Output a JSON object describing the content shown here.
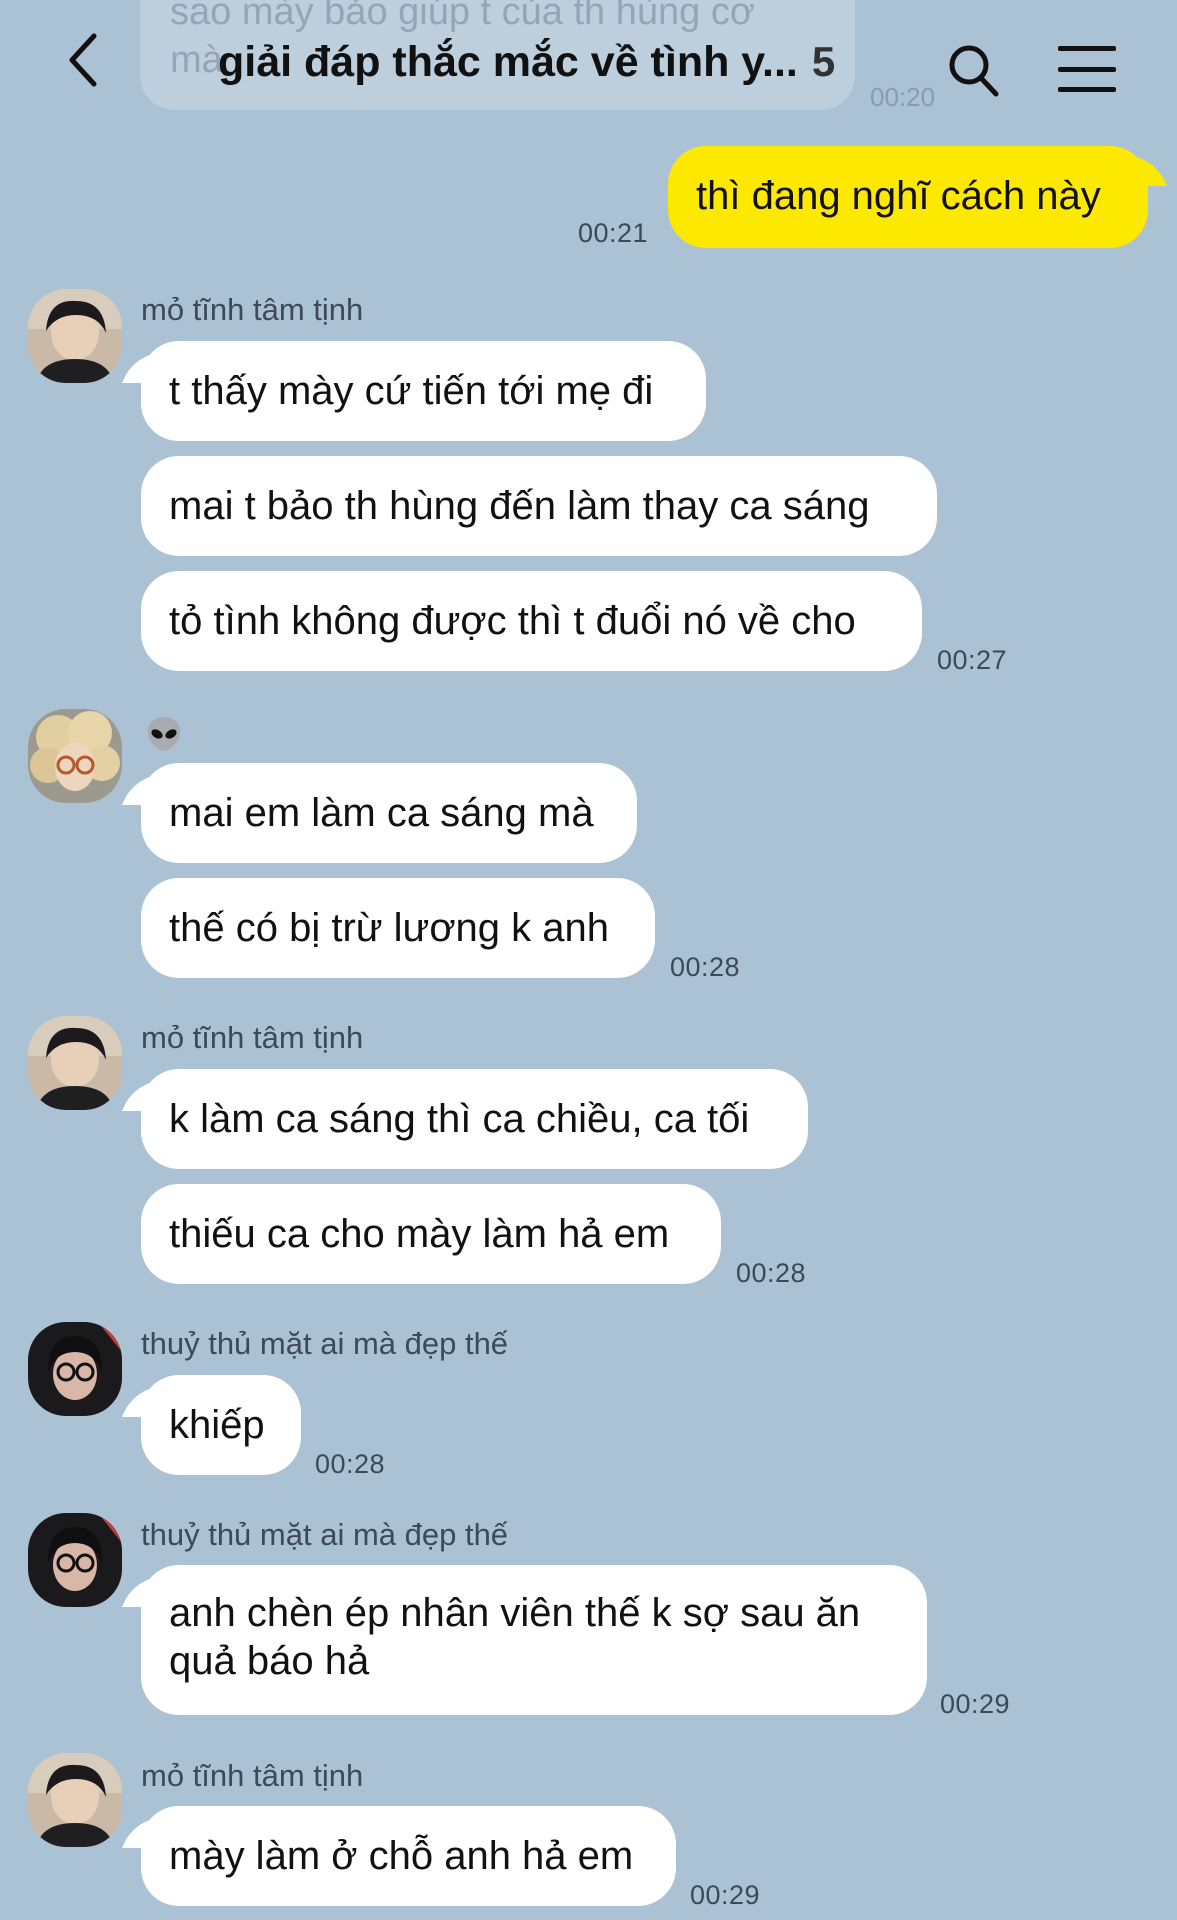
{
  "header": {
    "title": "giải đáp thắc mắc về tình y...",
    "member_count": "5",
    "ghost_text_line1": "sao mày bảo giúp t của th hùng cơ",
    "ghost_text_line2": "mà",
    "ghost_time": "00:20"
  },
  "icons": {
    "back": "chevron-left-icon",
    "search": "search-icon",
    "menu": "hamburger-menu-icon",
    "alien": "alien-emoji"
  },
  "colors": {
    "background": "#abc1d4",
    "my_bubble": "#fde800",
    "other_bubble": "#ffffff"
  },
  "messages": [
    {
      "sender": "",
      "text": "thì đang nghĩ cách này",
      "time": "00:21"
    },
    {
      "sender": "mỏ tĩnh tâm tịnh",
      "text": "t thấy mày cứ tiến tới mẹ đi"
    },
    {
      "text": "mai t bảo th hùng đến làm thay ca sáng"
    },
    {
      "text": "tỏ tình không được thì t đuổi nó về cho",
      "time": "00:27"
    },
    {
      "sender": "👽",
      "text": "mai em làm ca sáng mà"
    },
    {
      "text": "thế có bị trừ lương k anh",
      "time": "00:28"
    },
    {
      "sender": "mỏ tĩnh tâm tịnh",
      "text": "k làm ca sáng thì ca chiều, ca tối"
    },
    {
      "text": "thiếu ca cho mày làm hả em",
      "time": "00:28"
    },
    {
      "sender": "thuỷ thủ mặt ai mà đẹp thế",
      "text": "khiếp",
      "time": "00:28"
    },
    {
      "sender": "thuỷ thủ mặt ai mà đẹp thế",
      "text": "anh chèn ép nhân viên thế k sợ sau ăn quả báo hả",
      "time": "00:29"
    },
    {
      "sender": "mỏ tĩnh tâm tịnh",
      "text": "mày làm ở chỗ anh hả em",
      "time": "00:29"
    }
  ]
}
